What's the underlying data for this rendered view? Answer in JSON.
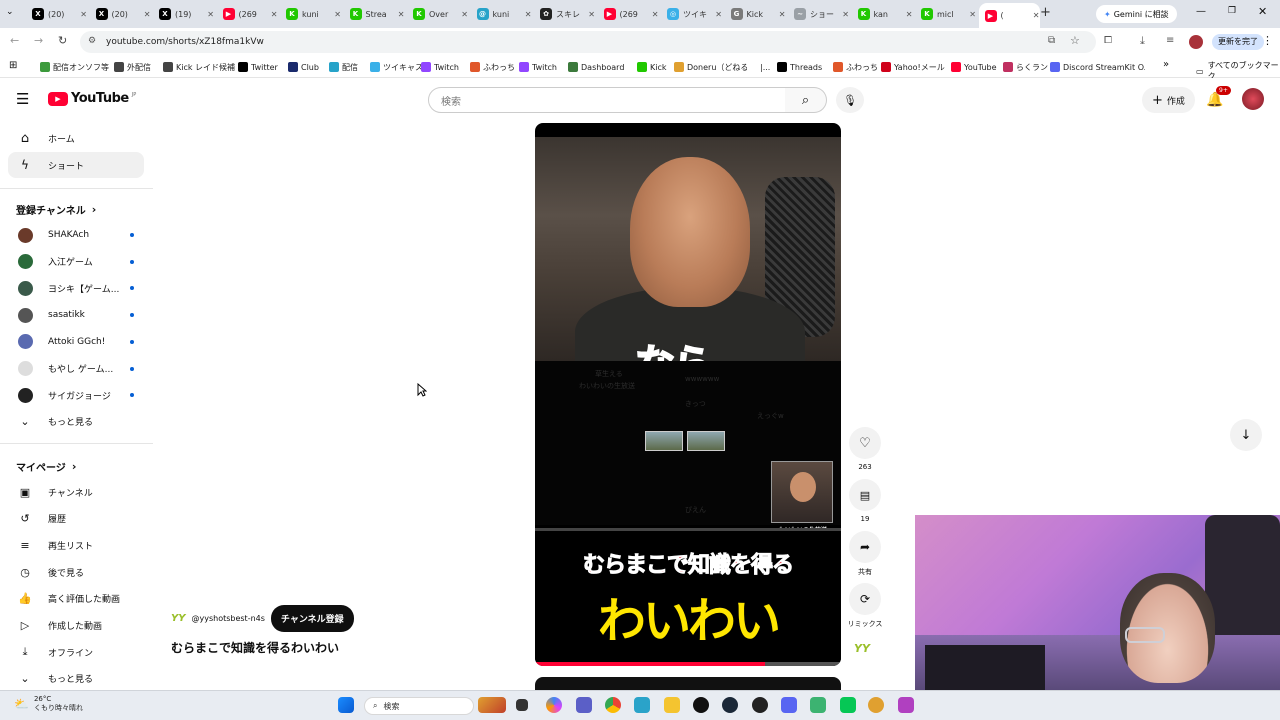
{
  "browser": {
    "tabs": [
      {
        "label": "(20)",
        "fav": "x-icon",
        "color": "#000000",
        "glyph": "X"
      },
      {
        "label": "(20)",
        "fav": "x-icon",
        "color": "#000000",
        "glyph": "X"
      },
      {
        "label": "(19)",
        "fav": "x-icon",
        "color": "#000000",
        "glyph": "X"
      },
      {
        "label": "(269",
        "fav": "youtube-icon",
        "color": "#ff0033",
        "glyph": "▶"
      },
      {
        "label": "kuni",
        "fav": "kick-icon",
        "color": "#21c800",
        "glyph": "K"
      },
      {
        "label": "Strea",
        "fav": "kick-icon",
        "color": "#21c800",
        "glyph": "K"
      },
      {
        "label": "Over",
        "fav": "kick-icon",
        "color": "#21c800",
        "glyph": "K"
      },
      {
        "label": "kuni",
        "fav": "spiral-icon",
        "color": "#27a3c9",
        "glyph": "@"
      },
      {
        "label": "スキレ",
        "fav": "chatgpt-icon",
        "color": "#222222",
        "glyph": "✿"
      },
      {
        "label": "(269",
        "fav": "youtube-icon",
        "color": "#ff0033",
        "glyph": "▶"
      },
      {
        "label": "ツイキ",
        "fav": "twitcasting-icon",
        "color": "#3ab0e8",
        "glyph": "◎"
      },
      {
        "label": "Kick",
        "fav": "google-search-icon",
        "color": "#7a7a7a",
        "glyph": "G"
      },
      {
        "label": "ショー",
        "fav": "generic-icon",
        "color": "#9aa0a6",
        "glyph": "~"
      },
      {
        "label": "kan",
        "fav": "kick-icon",
        "color": "#21c800",
        "glyph": "K"
      },
      {
        "label": "micl",
        "fav": "kick-icon",
        "color": "#21c800",
        "glyph": "K"
      },
      {
        "label": "(",
        "fav": "youtube-icon",
        "color": "#ff0033",
        "glyph": "▶"
      }
    ],
    "new_tab_label": "+",
    "gemini_label": "Gemini に相談",
    "url": "youtube.com/shorts/xZ18fma1kVw",
    "update_label": "更新を完了",
    "bookmarks": [
      {
        "label": "配信オンソフ等",
        "color": "#3c9a3c"
      },
      {
        "label": "外配信",
        "color": "#444444"
      },
      {
        "label": "Kick レイド候補",
        "color": "#444444"
      },
      {
        "label": "Twitter",
        "color": "#000000"
      },
      {
        "label": "Club",
        "color": "#1a2a6c"
      },
      {
        "label": "配信",
        "color": "#27a3c9"
      },
      {
        "label": "ツイキャス",
        "color": "#3ab0e8"
      },
      {
        "label": "Twitch",
        "color": "#9146ff"
      },
      {
        "label": "ふわっち",
        "color": "#e0572a"
      },
      {
        "label": "Twitch",
        "color": "#9146ff"
      },
      {
        "label": "Dashboard",
        "color": "#3c7a3c"
      },
      {
        "label": "Kick",
        "color": "#21c800"
      },
      {
        "label": "Doneru（どねる）",
        "color": "#e0a030"
      },
      {
        "label": "|...",
        "color": "#ffffff"
      },
      {
        "label": "Threads",
        "color": "#000000"
      },
      {
        "label": "ふわっち",
        "color": "#e0572a"
      },
      {
        "label": "Yahoo!メール",
        "color": "#d0021b"
      },
      {
        "label": "YouTube",
        "color": "#ff0033"
      },
      {
        "label": "らくラン",
        "color": "#c03060"
      },
      {
        "label": "Discord StreamKit O...",
        "color": "#5865f2"
      }
    ],
    "bookmarks_more": "»",
    "all_bookmarks": "すべてのブックマーク"
  },
  "youtube": {
    "logo_text": "YouTube",
    "logo_region": "JP",
    "search_placeholder": "検索",
    "create_label": "作成",
    "notification_count": "9+",
    "sidebar": {
      "home": "ホーム",
      "shorts": "ショート",
      "subscriptions_header": "登録チャンネル",
      "channels": [
        {
          "name": "SHAKAch",
          "color": "#6a3a2a"
        },
        {
          "name": "入江ゲーム",
          "color": "#2a6a3a"
        },
        {
          "name": "ヨシキ【ゲーム...",
          "color": "#3a5a4a"
        },
        {
          "name": "sasatikk",
          "color": "#555555"
        },
        {
          "name": "Attoki GGch!",
          "color": "#5a6ab0"
        },
        {
          "name": "もやし ゲーム...",
          "color": "#dddddd"
        },
        {
          "name": "サイガジョージ",
          "color": "#222222"
        }
      ],
      "show_more": "もっと見る",
      "you_header": "マイページ",
      "you_items": [
        "チャンネル",
        "履歴",
        "再生リスト",
        "後で見る",
        "高く評価した動画",
        "作成した動画",
        "オフライン",
        "もっと見る"
      ]
    },
    "short": {
      "overlay_top_text": "なら",
      "overlay_title_line1": "むらまこで知識を得る",
      "overlay_title_line2": "わいわい",
      "pip_label": "わいわいの生放送",
      "progress_fraction": 0.75,
      "comment_lines": [
        "草生える",
        "わいわいの生放送",
        "wwwwww",
        "きっつ",
        "えっぐw",
        "ぴえん"
      ],
      "channel_handle": "@yyshotsbest-n4s",
      "subscribe_label": "チャンネル登録",
      "title": "むらまこで知識を得るわいわい",
      "like_count": "263",
      "comment_count": "19",
      "share_label": "共有",
      "remix_label": "リミックス",
      "channel_badge": "YY"
    }
  },
  "taskbar": {
    "temperature": "26°C",
    "weather_text": "くもり時々晴れ",
    "search_label": "検索"
  }
}
